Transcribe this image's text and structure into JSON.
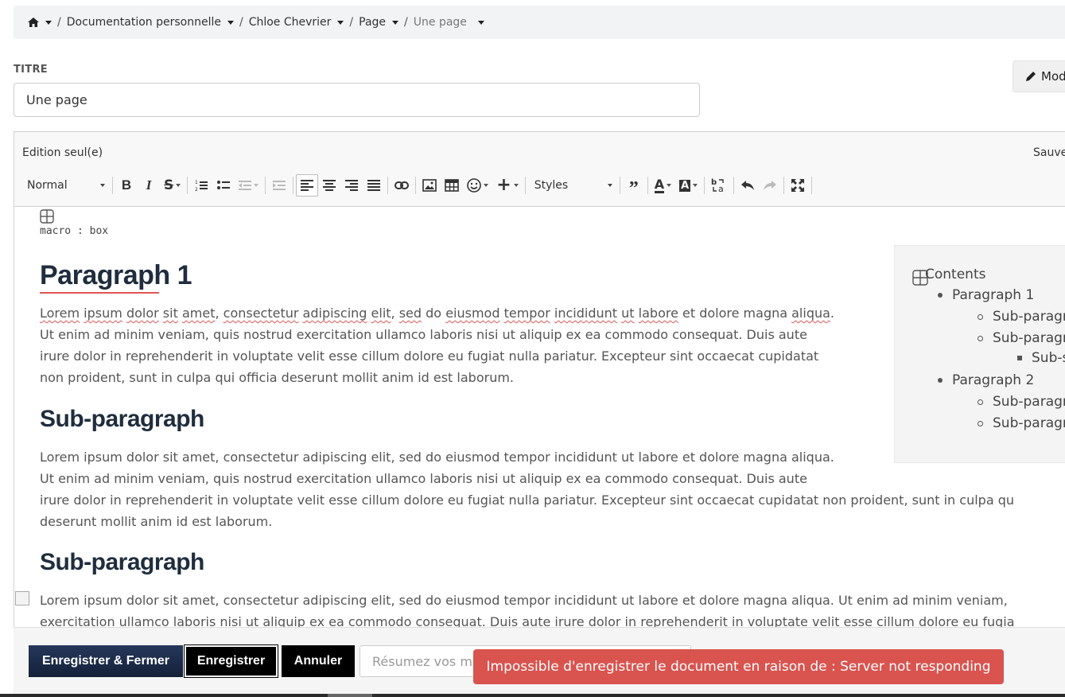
{
  "breadcrumb": {
    "items": [
      "Documentation personnelle",
      "Chloe Chevrier",
      "Page"
    ],
    "current": "Une page",
    "separator": "/"
  },
  "title_field": {
    "label": "TITRE",
    "value": "Une page"
  },
  "modify_button": {
    "label": "Mod"
  },
  "editor": {
    "edit_mode": "Edition seul(e)",
    "save_status": "Sauve",
    "toolbar": {
      "format_select": "Normal",
      "styles_select": "Styles",
      "icons": [
        "bold-icon",
        "italic-icon",
        "strikethrough-icon",
        "numbered-list-icon",
        "bulleted-list-icon",
        "outdent-icon",
        "indent-icon",
        "align-left-icon",
        "align-center-icon",
        "align-right-icon",
        "justify-icon",
        "link-icon",
        "image-icon",
        "table-icon",
        "emoji-icon",
        "insert-plus-icon",
        "blockquote-icon",
        "text-color-icon",
        "background-color-icon",
        "language-icon",
        "undo-icon",
        "redo-icon",
        "maximize-icon"
      ]
    }
  },
  "content": {
    "macro_label": "macro : box",
    "heading1": "Paragraph 1",
    "para1_spell": [
      "Lorem",
      "ipsum",
      "dolor",
      "sit",
      "amet",
      "consectetur",
      "adipiscing",
      "elit",
      "sed",
      "eiusmod",
      "tempor",
      "incididunt",
      "ut",
      "labore",
      "aliqua"
    ],
    "para1_lines": [
      "Lorem ipsum dolor sit amet, consectetur adipiscing elit, sed do eiusmod tempor incididunt ut labore et dolore magna aliqua.",
      "Ut enim ad minim veniam, quis nostrud exercitation ullamco laboris nisi ut aliquip ex ea commodo consequat. Duis aute",
      "irure dolor in reprehenderit in voluptate velit esse cillum dolore eu fugiat nulla pariatur. Excepteur sint occaecat cupidatat",
      "non proident, sunt in culpa qui officia deserunt mollit anim id est laborum."
    ],
    "heading2a": "Sub-paragraph",
    "para2_lines": [
      "Lorem ipsum dolor sit amet, consectetur adipiscing elit, sed do eiusmod tempor incididunt ut labore et dolore magna aliqua.",
      "Ut enim ad minim veniam, quis nostrud exercitation ullamco laboris nisi ut aliquip ex ea commodo consequat. Duis aute",
      "irure dolor in reprehenderit in voluptate velit esse cillum dolore eu fugiat nulla pariatur. Excepteur sint occaecat cupidatat non proident, sunt in culpa qu",
      "deserunt mollit anim id est laborum."
    ],
    "heading2b": "Sub-paragraph",
    "para3_lines": [
      "Lorem ipsum dolor sit amet, consectetur adipiscing elit, sed do eiusmod tempor incididunt ut labore et dolore magna aliqua. Ut enim ad minim veniam,",
      "exercitation ullamco laboris nisi ut aliquip ex ea commodo consequat. Duis aute irure dolor in reprehenderit in voluptate velit esse cillum dolore eu fugia"
    ]
  },
  "toc": {
    "title": "Contents",
    "items": [
      {
        "level": 1,
        "label": "Paragraph 1"
      },
      {
        "level": 2,
        "label": "Sub-paragr"
      },
      {
        "level": 2,
        "label": "Sub-paragr"
      },
      {
        "level": 3,
        "label": "Sub-s"
      },
      {
        "level": 1,
        "label": "Paragraph 2"
      },
      {
        "level": 2,
        "label": "Sub-paragr"
      },
      {
        "level": 2,
        "label": "Sub-paragr"
      }
    ]
  },
  "footer": {
    "save_close_label": "Enregistrer & Fermer",
    "save_label": "Enregistrer",
    "cancel_label": "Annuler",
    "summary_placeholder": "Résumez vos mo"
  },
  "error_message": "Impossible d'enregistrer le document en raison de : Server not responding",
  "colors": {
    "error": "#d9534f",
    "primary_button": "#1b2a47",
    "heading": "#1f2d3d",
    "spellcheck": "#e05555"
  }
}
